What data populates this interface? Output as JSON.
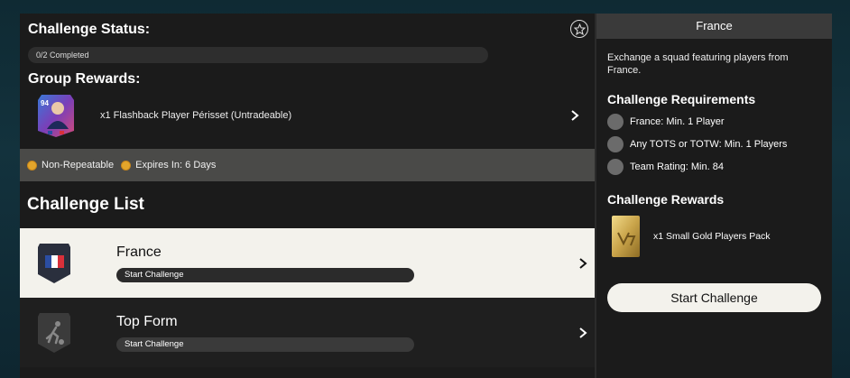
{
  "challenge": {
    "status_title": "Challenge Status:",
    "progress_text": "0/2 Completed",
    "progress_fraction": 0,
    "group_rewards_title": "Group Rewards:",
    "reward": {
      "rating": "94",
      "text": "x1 Flashback Player Périsset (Untradeable)"
    },
    "info": {
      "repeat": "Non-Repeatable",
      "expires": "Expires In: 6 Days"
    },
    "list_title": "Challenge List",
    "items": [
      {
        "name": "France",
        "action": "Start Challenge"
      },
      {
        "name": "Top Form",
        "action": "Start Challenge"
      }
    ]
  },
  "detail": {
    "title": "France",
    "description": "Exchange a squad featuring players from France.",
    "requirements_title": "Challenge Requirements",
    "requirements": [
      "France: Min. 1 Player",
      "Any TOTS or TOTW: Min. 1 Players",
      "Team Rating: Min. 84"
    ],
    "rewards_title": "Challenge Rewards",
    "reward_text": "x1 Small Gold Players Pack",
    "start_button": "Start Challenge"
  },
  "colors": {
    "active_item_bg": "#f3f2ec",
    "coin": "#e3a52b",
    "flag_blue": "#2b4ea3",
    "flag_red": "#d9303a"
  }
}
